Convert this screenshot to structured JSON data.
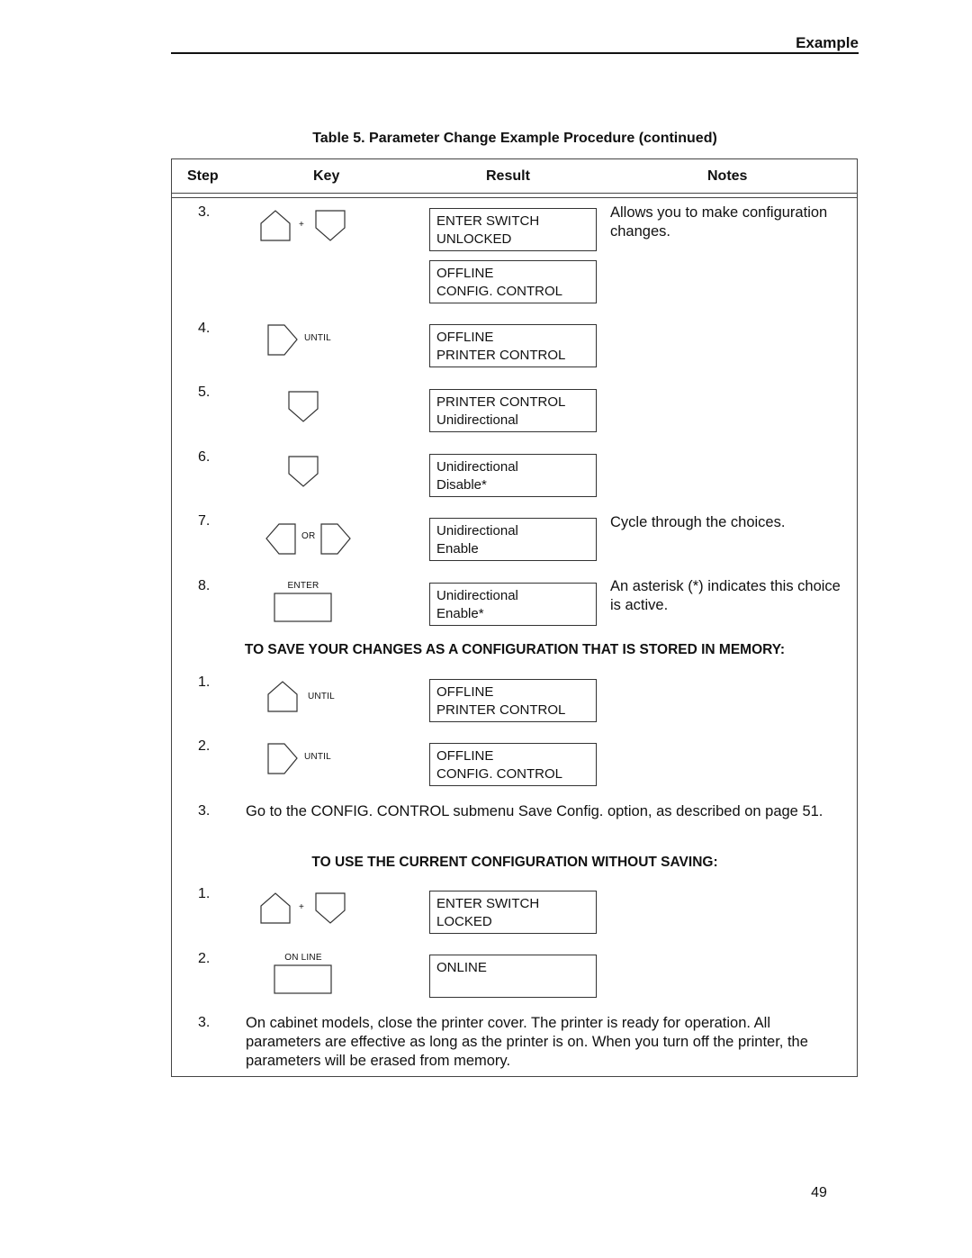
{
  "running_head": "Example",
  "caption": "Table 5. Parameter Change Example Procedure (continued)",
  "columns": {
    "step": "Step",
    "key": "Key",
    "result": "Result",
    "notes": "Notes"
  },
  "rows": [
    {
      "step": "3.",
      "key": "up + down",
      "key_connector": "+",
      "results": [
        [
          "ENTER SWITCH",
          "UNLOCKED"
        ],
        [
          "OFFLINE",
          "CONFIG. CONTROL"
        ]
      ],
      "note": "Allows you to make configuration changes."
    },
    {
      "step": "4.",
      "key": "next",
      "key_label": "UNTIL",
      "results": [
        [
          "OFFLINE",
          "PRINTER CONTROL"
        ]
      ],
      "note": ""
    },
    {
      "step": "5.",
      "key": "down",
      "results": [
        [
          "PRINTER CONTROL",
          "Unidirectional"
        ]
      ],
      "note": ""
    },
    {
      "step": "6.",
      "key": "down",
      "results": [
        [
          "Unidirectional",
          "Disable*"
        ]
      ],
      "note": ""
    },
    {
      "step": "7.",
      "key": "prev or next",
      "key_connector": "OR",
      "results": [
        [
          "Unidirectional",
          "Enable"
        ]
      ],
      "note": "Cycle through the choices."
    },
    {
      "step": "8.",
      "key": "enter",
      "key_label": "ENTER",
      "results": [
        [
          "Unidirectional",
          "Enable*"
        ]
      ],
      "note": "An asterisk (*) indicates this choice is active."
    }
  ],
  "save_section": {
    "title": "TO SAVE YOUR CHANGES AS A CONFIGURATION THAT IS STORED IN MEMORY:",
    "rows": [
      {
        "step": "1.",
        "key": "up",
        "key_label": "UNTIL",
        "results": [
          [
            "OFFLINE",
            "PRINTER CONTROL"
          ]
        ]
      },
      {
        "step": "2.",
        "key": "next",
        "key_label": "UNTIL",
        "results": [
          [
            "OFFLINE",
            "CONFIG. CONTROL"
          ]
        ]
      }
    ],
    "step3": {
      "step": "3.",
      "text": "Go to the CONFIG. CONTROL submenu Save Config. option, as described on page 51."
    }
  },
  "nosave_section": {
    "title": "TO USE THE CURRENT CONFIGURATION WITHOUT SAVING:",
    "rows": [
      {
        "step": "1.",
        "key": "up + down",
        "key_connector": "+",
        "results": [
          [
            "ENTER SWITCH",
            "LOCKED"
          ]
        ]
      },
      {
        "step": "2.",
        "key": "online",
        "key_label": "ON LINE",
        "results": [
          [
            "ONLINE",
            ""
          ]
        ]
      }
    ],
    "step3": {
      "step": "3.",
      "text": "On cabinet models, close the printer cover. The printer is ready for operation. All parameters are effective as long as the printer is on. When you turn off the printer, the parameters will be erased from memory."
    }
  },
  "page_number": "49"
}
